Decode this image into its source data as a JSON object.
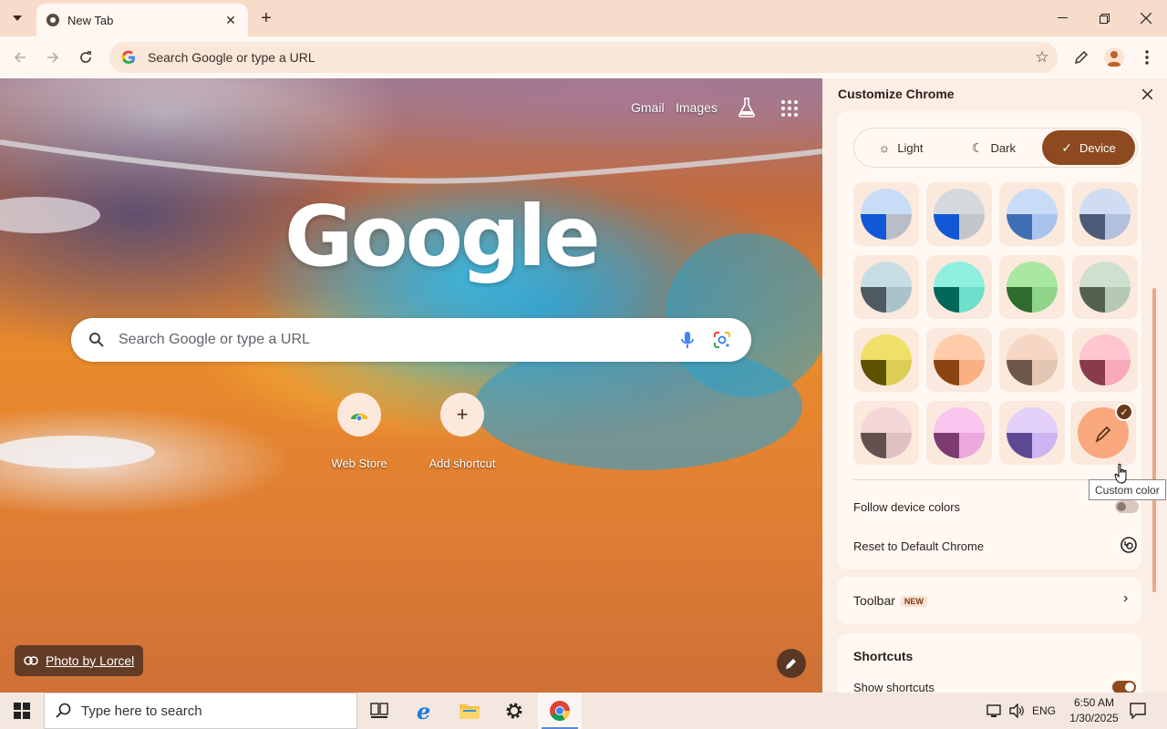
{
  "browser": {
    "tab_title": "New Tab",
    "omnibox_placeholder": "Search Google or type a URL"
  },
  "ntp": {
    "gmail_link": "Gmail",
    "images_link": "Images",
    "logo_text": "Google",
    "search_placeholder": "Search Google or type a URL",
    "shortcuts": [
      {
        "label": "Web Store"
      },
      {
        "label": "Add shortcut"
      }
    ],
    "photo_credit": "Photo by Lorcel"
  },
  "panel": {
    "title": "Customize Chrome",
    "modes": [
      {
        "label": "Light",
        "icon": "sun-icon",
        "active": false
      },
      {
        "label": "Dark",
        "icon": "moon-icon",
        "active": false
      },
      {
        "label": "Device",
        "icon": "check-icon",
        "active": true
      }
    ],
    "swatches": [
      {
        "name": "blue",
        "top": "#c9dcf7",
        "left": "#1158d6",
        "right": "#b8bec7"
      },
      {
        "name": "grey-blue",
        "top": "#d5d8dc",
        "left": "#1158d6",
        "right": "#c2c6cb"
      },
      {
        "name": "light-blue",
        "top": "#c9dcf7",
        "left": "#3f6fb3",
        "right": "#a8c4ee"
      },
      {
        "name": "slate",
        "top": "#cfdcf2",
        "left": "#4b5a78",
        "right": "#b2c0dc"
      },
      {
        "name": "aqua-grey",
        "top": "#c6dde3",
        "left": "#4d5a5f",
        "right": "#a9c3cb"
      },
      {
        "name": "teal",
        "top": "#8ff0e0",
        "left": "#00695c",
        "right": "#6fdfcc"
      },
      {
        "name": "green",
        "top": "#a8e8a0",
        "left": "#2e6b2d",
        "right": "#8fd488"
      },
      {
        "name": "sage",
        "top": "#cfe0cf",
        "left": "#55614f",
        "right": "#b6c9b4"
      },
      {
        "name": "yellow",
        "top": "#efe06a",
        "left": "#5f5200",
        "right": "#dccd55"
      },
      {
        "name": "orange",
        "top": "#ffcba8",
        "left": "#8a4512",
        "right": "#f9b083"
      },
      {
        "name": "beige",
        "top": "#f5d5c3",
        "left": "#6e584b",
        "right": "#e2c5b3"
      },
      {
        "name": "rose",
        "top": "#ffc6d1",
        "left": "#8a3a4d",
        "right": "#f7a8b9"
      },
      {
        "name": "mauve",
        "top": "#f3d6d8",
        "left": "#655050",
        "right": "#dfc0c2"
      },
      {
        "name": "pink",
        "top": "#f8c6ef",
        "left": "#7d3b72",
        "right": "#eba8dd"
      },
      {
        "name": "violet",
        "top": "#e3d1fb",
        "left": "#5e4a94",
        "right": "#cdb4f2"
      }
    ],
    "custom_color_label": "Custom color",
    "follow_device_colors": "Follow device colors",
    "reset_label": "Reset to Default Chrome",
    "toolbar_label": "Toolbar",
    "new_badge": "NEW",
    "shortcuts_label": "Shortcuts",
    "shortcuts_sub": "Show shortcuts"
  },
  "taskbar": {
    "search_placeholder": "Type here to search",
    "language": "ENG",
    "time": "6:50 AM",
    "date": "1/30/2025"
  }
}
